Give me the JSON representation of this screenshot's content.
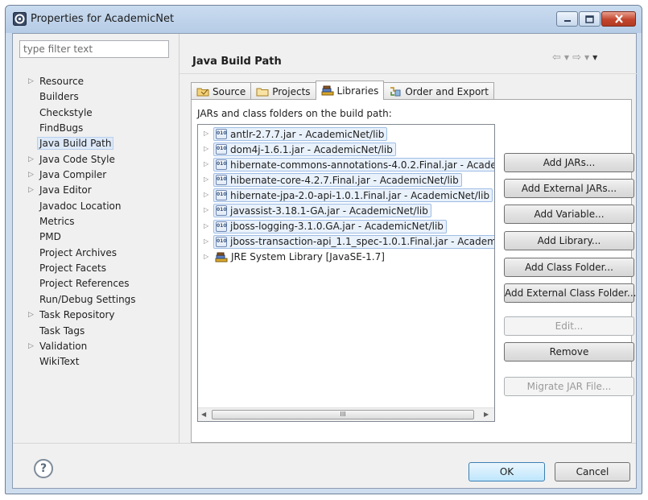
{
  "window": {
    "title": "Properties for AcademicNet",
    "controls": [
      "minimize",
      "maximize",
      "close"
    ]
  },
  "filter": {
    "placeholder": "type filter text"
  },
  "tree": {
    "items": [
      {
        "label": "Resource",
        "expandable": true
      },
      {
        "label": "Builders",
        "expandable": false
      },
      {
        "label": "Checkstyle",
        "expandable": false
      },
      {
        "label": "FindBugs",
        "expandable": false
      },
      {
        "label": "Java Build Path",
        "expandable": false,
        "selected": true
      },
      {
        "label": "Java Code Style",
        "expandable": true
      },
      {
        "label": "Java Compiler",
        "expandable": true
      },
      {
        "label": "Java Editor",
        "expandable": true
      },
      {
        "label": "Javadoc Location",
        "expandable": false
      },
      {
        "label": "Metrics",
        "expandable": false
      },
      {
        "label": "PMD",
        "expandable": false
      },
      {
        "label": "Project Archives",
        "expandable": false
      },
      {
        "label": "Project Facets",
        "expandable": false
      },
      {
        "label": "Project References",
        "expandable": false
      },
      {
        "label": "Run/Debug Settings",
        "expandable": false
      },
      {
        "label": "Task Repository",
        "expandable": true
      },
      {
        "label": "Task Tags",
        "expandable": false
      },
      {
        "label": "Validation",
        "expandable": true
      },
      {
        "label": "WikiText",
        "expandable": false
      }
    ]
  },
  "page": {
    "title": "Java Build Path"
  },
  "tabs": [
    {
      "label": "Source",
      "icon": "source-folder-icon"
    },
    {
      "label": "Projects",
      "icon": "projects-folder-icon"
    },
    {
      "label": "Libraries",
      "icon": "libraries-icon",
      "active": true
    },
    {
      "label": "Order and Export",
      "icon": "order-export-icon"
    }
  ],
  "libraries": {
    "heading": "JARs and class folders on the build path:",
    "items": [
      {
        "label": "antlr-2.7.7.jar - AcademicNet/lib",
        "type": "jar"
      },
      {
        "label": "dom4j-1.6.1.jar - AcademicNet/lib",
        "type": "jar"
      },
      {
        "label": "hibernate-commons-annotations-4.0.2.Final.jar - Acade",
        "type": "jar"
      },
      {
        "label": "hibernate-core-4.2.7.Final.jar - AcademicNet/lib",
        "type": "jar"
      },
      {
        "label": "hibernate-jpa-2.0-api-1.0.1.Final.jar - AcademicNet/lib",
        "type": "jar"
      },
      {
        "label": "javassist-3.18.1-GA.jar - AcademicNet/lib",
        "type": "jar"
      },
      {
        "label": "jboss-logging-3.1.0.GA.jar - AcademicNet/lib",
        "type": "jar"
      },
      {
        "label": "jboss-transaction-api_1.1_spec-1.0.1.Final.jar - Academi",
        "type": "jar"
      },
      {
        "label": "JRE System Library [JavaSE-1.7]",
        "type": "library"
      }
    ],
    "scroll_thumb_label": "III"
  },
  "buttons": {
    "add_jars": "Add JARs...",
    "add_external_jars": "Add External JARs...",
    "add_variable": "Add Variable...",
    "add_library": "Add Library...",
    "add_class_folder": "Add Class Folder...",
    "add_external_class_folder": "Add External Class Folder...",
    "edit": "Edit...",
    "remove": "Remove",
    "migrate_jar": "Migrate JAR File..."
  },
  "footer": {
    "help": "?",
    "ok": "OK",
    "cancel": "Cancel"
  },
  "colors": {
    "title_bar": "#b6cce6",
    "close_button": "#c2452d",
    "selection": "#dde9f8",
    "ok_button": "#bee6fd"
  }
}
